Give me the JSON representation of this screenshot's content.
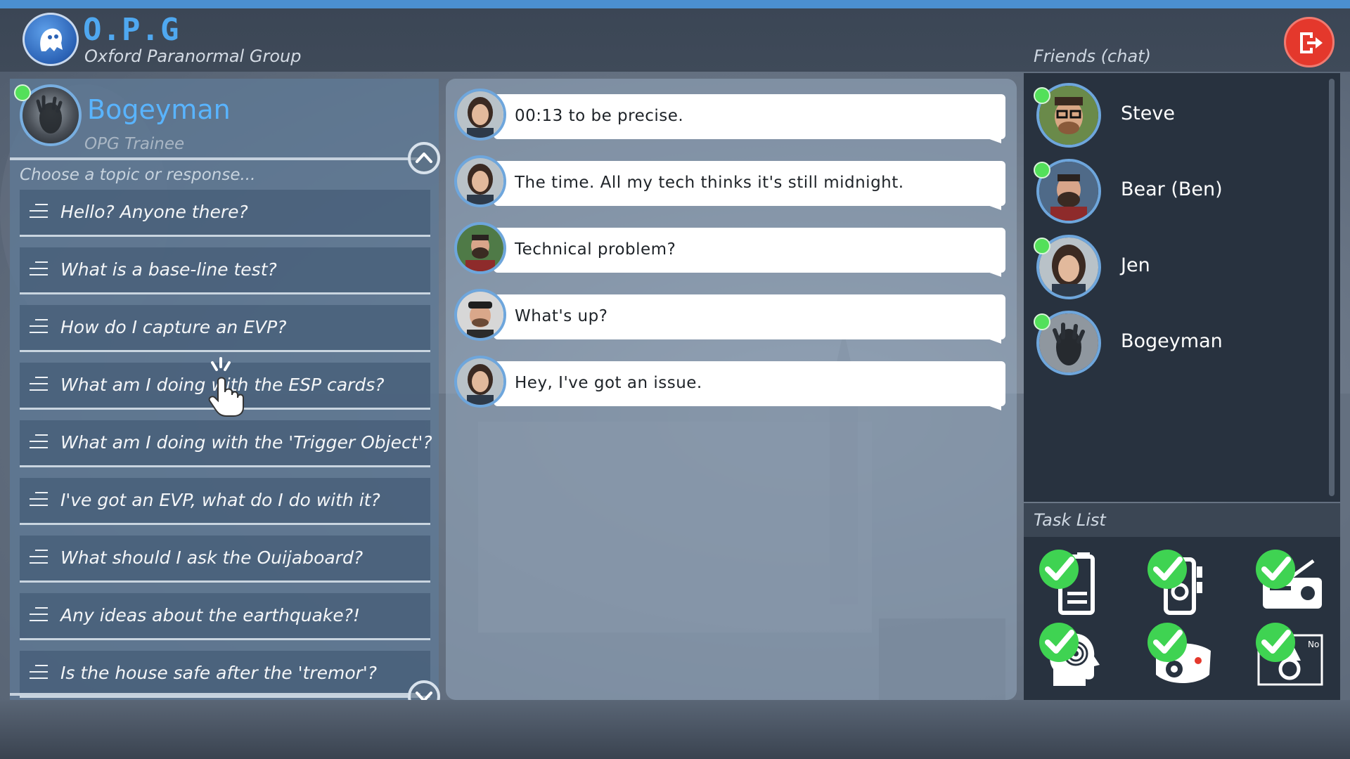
{
  "header": {
    "title": "O.P.G",
    "subtitle": "Oxford Paranormal Group"
  },
  "player": {
    "name": "Bogeyman",
    "role": "OPG Trainee",
    "online": true
  },
  "topics": {
    "prompt": "Choose a topic or response...",
    "items": [
      {
        "label": "Hello? Anyone there?"
      },
      {
        "label": "What is a base-line test?"
      },
      {
        "label": "How do I capture an EVP?"
      },
      {
        "label": "What am I doing with the ESP cards?"
      },
      {
        "label": "What am I doing with the 'Trigger Object'?"
      },
      {
        "label": "I've got an EVP, what do I do with it?"
      },
      {
        "label": "What should I ask the Ouijaboard?"
      },
      {
        "label": "Any ideas about the earthquake?!"
      },
      {
        "label": "Is the house safe after the 'tremor'?"
      }
    ]
  },
  "chat": {
    "messages": [
      {
        "sender": "Jen",
        "text": "00:13 to be precise."
      },
      {
        "sender": "Jen",
        "text": "The time. All my tech thinks it's still midnight."
      },
      {
        "sender": "Bear (Ben)",
        "text": "Technical problem?"
      },
      {
        "sender": "Steve",
        "text": "What's up?"
      },
      {
        "sender": "Jen",
        "text": "Hey, I've got an issue."
      }
    ]
  },
  "friends": {
    "title": "Friends (chat)",
    "items": [
      {
        "name": "Steve",
        "online": true
      },
      {
        "name": "Bear (Ben)",
        "online": true
      },
      {
        "name": "Jen",
        "online": true
      },
      {
        "name": "Bogeyman",
        "online": true
      }
    ]
  },
  "tasks": {
    "title": "Task List",
    "items": [
      {
        "icon": "clipboard-icon",
        "done": true
      },
      {
        "icon": "speaker-icon",
        "done": true
      },
      {
        "icon": "radio-icon",
        "done": true
      },
      {
        "icon": "esp-head-icon",
        "done": true
      },
      {
        "icon": "camera-icon",
        "done": true
      },
      {
        "icon": "ouija-board-icon",
        "done": true,
        "tag": "No"
      }
    ]
  },
  "colors": {
    "accent": "#4fa8f0",
    "online": "#53e05a",
    "check": "#3fd352",
    "exit": "#e4382c"
  }
}
